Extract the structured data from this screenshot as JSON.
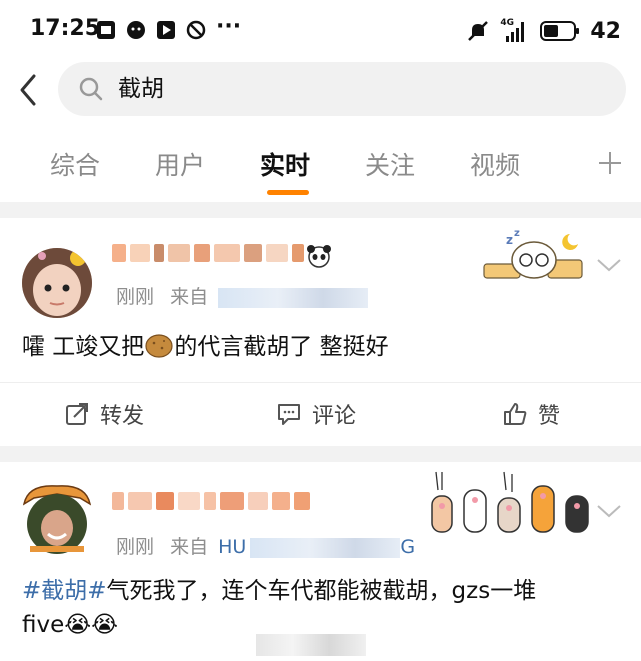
{
  "status_bar": {
    "time": "17:25",
    "more": "···",
    "battery": "42",
    "network": "4G"
  },
  "search": {
    "query": "截胡"
  },
  "tabs": [
    {
      "label": "综合"
    },
    {
      "label": "用户"
    },
    {
      "label": "实时"
    },
    {
      "label": "关注"
    },
    {
      "label": "视频"
    }
  ],
  "posts": [
    {
      "time": "刚刚",
      "source_prefix": "来自",
      "text_before": "嚯 工竣又把",
      "text_after": "的代言截胡了 整挺好",
      "actions": {
        "repost": "转发",
        "comment": "评论",
        "like": "赞"
      }
    },
    {
      "time": "刚刚",
      "source_prefix": "来自",
      "source_partial": "HU",
      "source_suffix": "G",
      "hashtag": "#截胡#",
      "text": "气死我了，连个车代都能被截胡，gzs一堆",
      "text_line2": "five😭😭"
    }
  ],
  "colors": {
    "accent": "#ff8200",
    "hashtag": "#3d6ea9",
    "muted": "#8e8e8e",
    "tab_inactive": "#8a8a8a"
  }
}
